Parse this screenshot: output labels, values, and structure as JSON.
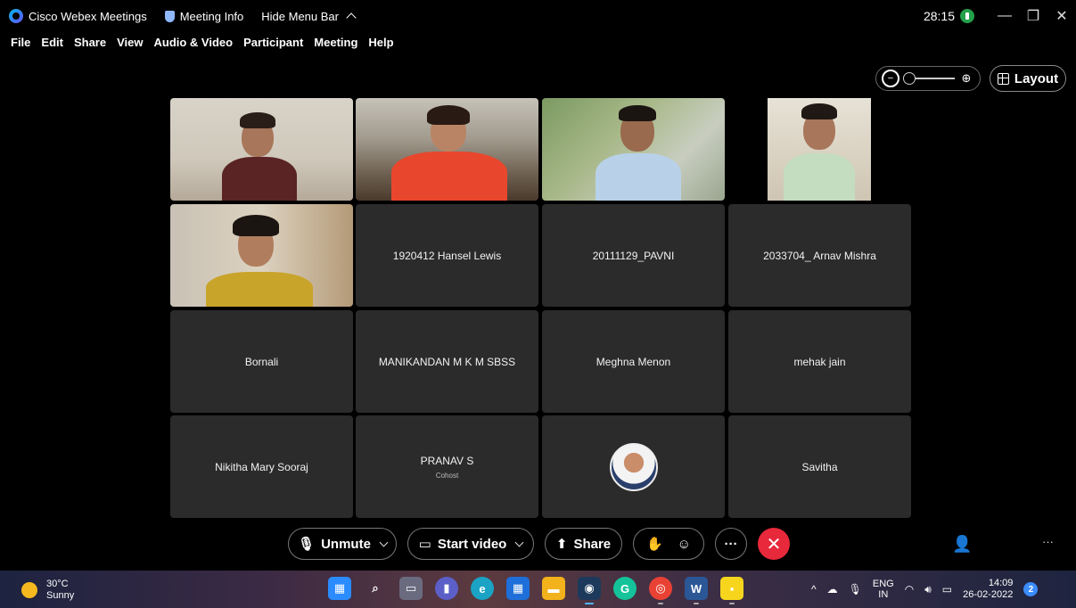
{
  "titlebar": {
    "app_name": "Cisco Webex Meetings",
    "meeting_info": "Meeting Info",
    "hide_menu": "Hide Menu Bar",
    "timer": "28:15",
    "minimize": "—",
    "restore": "❐",
    "close": "✕"
  },
  "menu": {
    "file": "File",
    "edit": "Edit",
    "share": "Share",
    "view": "View",
    "audio_video": "Audio & Video",
    "participant": "Participant",
    "meeting": "Meeting",
    "help": "Help"
  },
  "view_controls": {
    "layout_label": "Layout",
    "zoom_level": 0
  },
  "participants": [
    {
      "name": "",
      "video": true
    },
    {
      "name": "",
      "video": true
    },
    {
      "name": "",
      "video": true
    },
    {
      "name": "",
      "video": true
    },
    {
      "name": "",
      "video": true
    },
    {
      "name": "1920412 Hansel Lewis",
      "video": false
    },
    {
      "name": "20111129_PAVNI",
      "video": false
    },
    {
      "name": "2033704_ Arnav Mishra",
      "video": false
    },
    {
      "name": "Bornali",
      "video": false
    },
    {
      "name": "MANIKANDAN M K M SBSS",
      "video": false
    },
    {
      "name": "Meghna Menon",
      "video": false
    },
    {
      "name": "mehak jain",
      "video": false
    },
    {
      "name": "Nikitha Mary Sooraj",
      "video": false
    },
    {
      "name": "PRANAV S",
      "role": "Cohost",
      "video": false
    },
    {
      "name": "",
      "avatar": true
    },
    {
      "name": "Savitha",
      "video": false
    }
  ],
  "controls": {
    "unmute": "Unmute",
    "start_video": "Start video",
    "share": "Share",
    "more": "···",
    "end": "✕",
    "side_more": "···"
  },
  "taskbar": {
    "temperature": "30°C",
    "condition": "Sunny",
    "lang_top": "ENG",
    "lang_bottom": "IN",
    "time": "14:09",
    "date": "26-02-2022",
    "notifications": "2",
    "apps": [
      {
        "name": "start",
        "color": "#2b8cff"
      },
      {
        "name": "search",
        "color": "transparent"
      },
      {
        "name": "task-view",
        "color": "transparent"
      },
      {
        "name": "teams-chat",
        "color": "#5b5fc7"
      },
      {
        "name": "edge",
        "color": "#1aa3c4"
      },
      {
        "name": "store",
        "color": "#1e6fd9"
      },
      {
        "name": "file-explorer",
        "color": "#f2b21b"
      },
      {
        "name": "webex",
        "color": "#1d3a5c"
      },
      {
        "name": "grammarly",
        "color": "#15c39a"
      },
      {
        "name": "chrome",
        "color": "#e94235"
      },
      {
        "name": "word",
        "color": "#2b5797"
      },
      {
        "name": "sticky-notes",
        "color": "#f7d51d"
      }
    ]
  }
}
